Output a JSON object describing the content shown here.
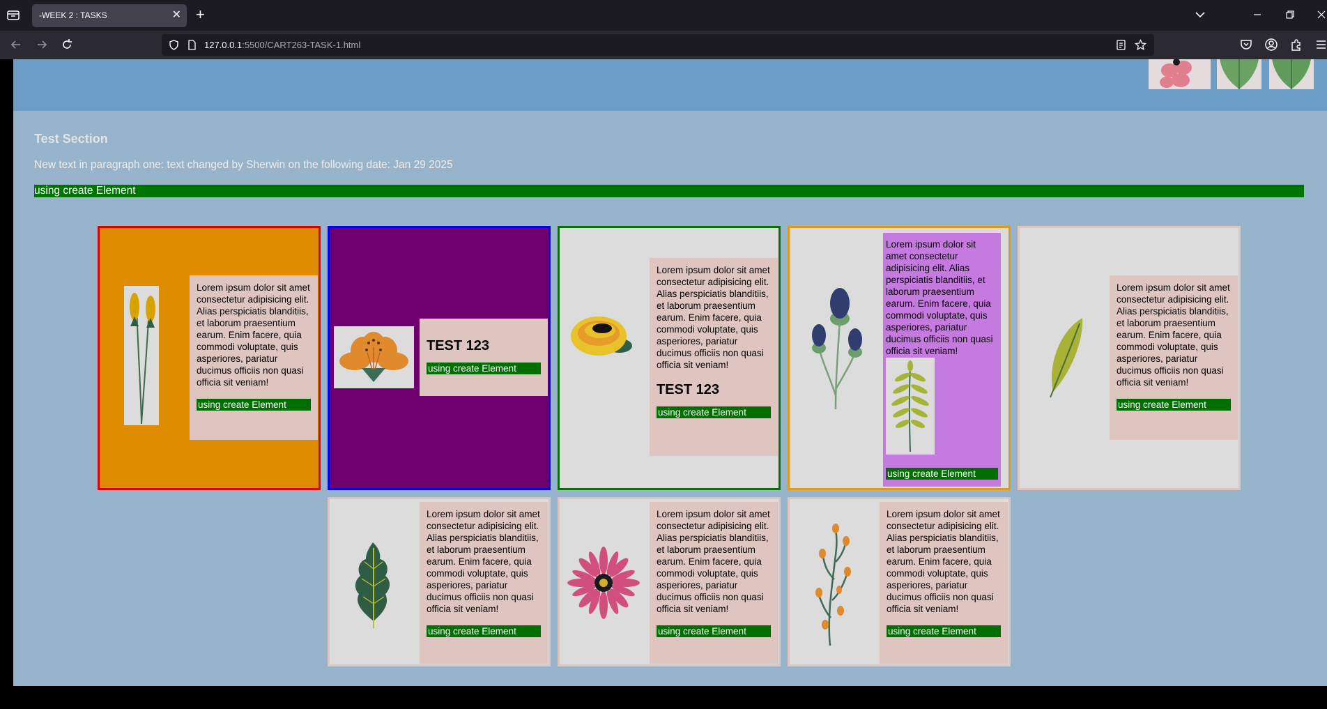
{
  "browser": {
    "tab_title": "-WEEK 2 : TASKS",
    "url_host": "127.0.0.1",
    "url_rest": ":5500/CART263-TASK-1.html"
  },
  "page": {
    "section_title": "Test Section",
    "paragraph": "New text in paragraph one: text changed by Sherwin on the following date: Jan 29 2025",
    "green_bar": "using create Element",
    "lorem": "Lorem ipsum dolor sit amet consectetur adipisicing elit. Alias perspiciatis blanditiis, et laborum praesentium earum. Enim facere, quia commodi voluptate, quis asperiores, pariatur ducimus officiis non quasi officia sit veniam!",
    "test_heading": "TEST 123",
    "button_label": "using create Element"
  },
  "colors": {
    "page_bg": "#98b4cb",
    "header_band": "#6b9dc6",
    "card1_fill": "#df8b00",
    "card1_border": "#e00000",
    "card2_fill": "#6d006d",
    "card2_border": "#0000ee",
    "card3_border": "#0a6e0a",
    "card4_border": "#e39a17",
    "card4_panel": "#c57ae0",
    "plain_border": "#dec5c0",
    "green": "#007400"
  },
  "icons": [
    "tab-list-icon",
    "new-tab-icon",
    "tabs-menu-icon",
    "minimize-icon",
    "restore-icon",
    "close-icon",
    "back-icon",
    "forward-icon",
    "reload-icon",
    "shield-icon",
    "page-icon",
    "reader-view-icon",
    "bookmark-star-icon",
    "pocket-icon",
    "account-icon",
    "extensions-icon",
    "menu-icon"
  ]
}
